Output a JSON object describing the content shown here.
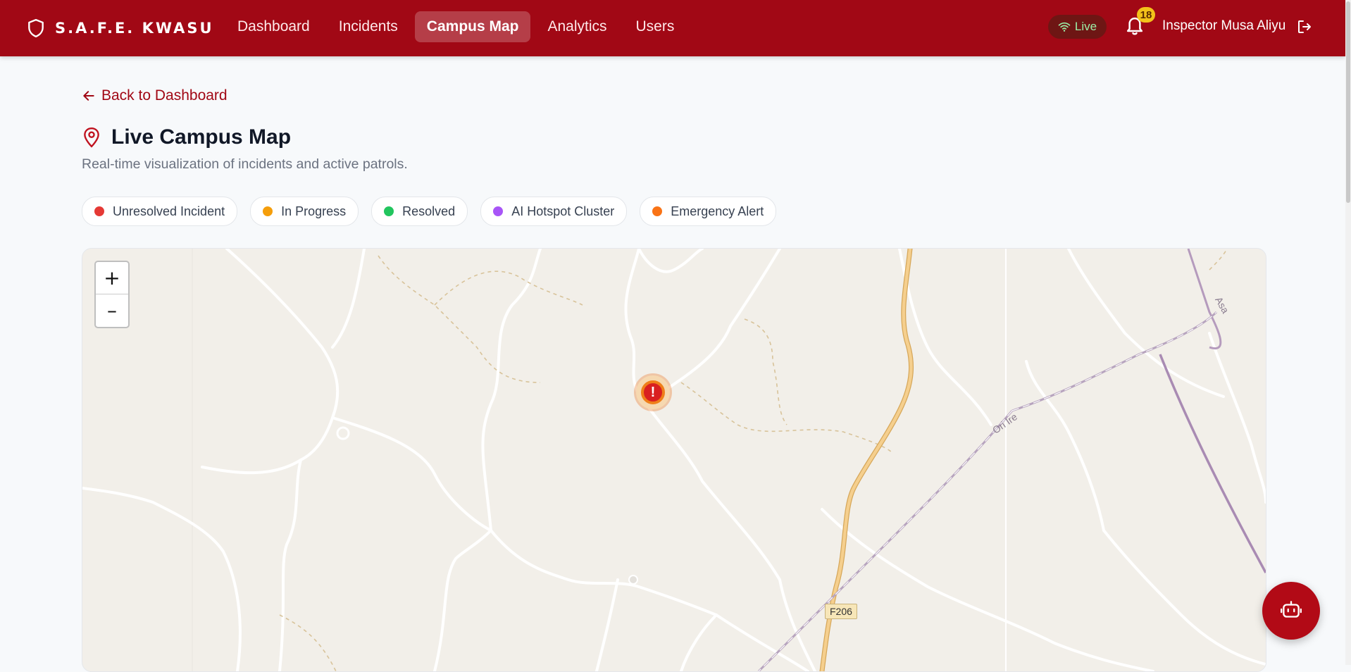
{
  "header": {
    "brand": "S.A.F.E. KWASU",
    "nav": [
      {
        "label": "Dashboard",
        "active": false
      },
      {
        "label": "Incidents",
        "active": false
      },
      {
        "label": "Campus Map",
        "active": true
      },
      {
        "label": "Analytics",
        "active": false
      },
      {
        "label": "Users",
        "active": false
      }
    ],
    "live_label": "Live",
    "notification_count": "18",
    "user_name": "Inspector Musa Aliyu"
  },
  "page": {
    "back_label": "Back to Dashboard",
    "title": "Live Campus Map",
    "subtitle": "Real-time visualization of incidents and active patrols."
  },
  "legend": [
    {
      "label": "Unresolved Incident",
      "color": "#e53935"
    },
    {
      "label": "In Progress",
      "color": "#f59e0b"
    },
    {
      "label": "Resolved",
      "color": "#22c55e"
    },
    {
      "label": "AI Hotspot Cluster",
      "color": "#a855f7"
    },
    {
      "label": "Emergency Alert",
      "color": "#f97316"
    }
  ],
  "map": {
    "zoom_in": "+",
    "zoom_out": "–",
    "marker_symbol": "!",
    "road_label": "F206",
    "place_label": "Ori Ire",
    "place_label_2": "Asa"
  },
  "colors": {
    "brand": "#a10815",
    "background": "#f7f9fb",
    "map_land": "#f2efe9"
  },
  "icons": {
    "brand": "shield-icon",
    "live": "wifi-icon",
    "notifications": "bell-icon",
    "logout": "logout-icon",
    "back": "arrow-left-icon",
    "title": "map-pin-icon",
    "fab": "robot-icon"
  }
}
